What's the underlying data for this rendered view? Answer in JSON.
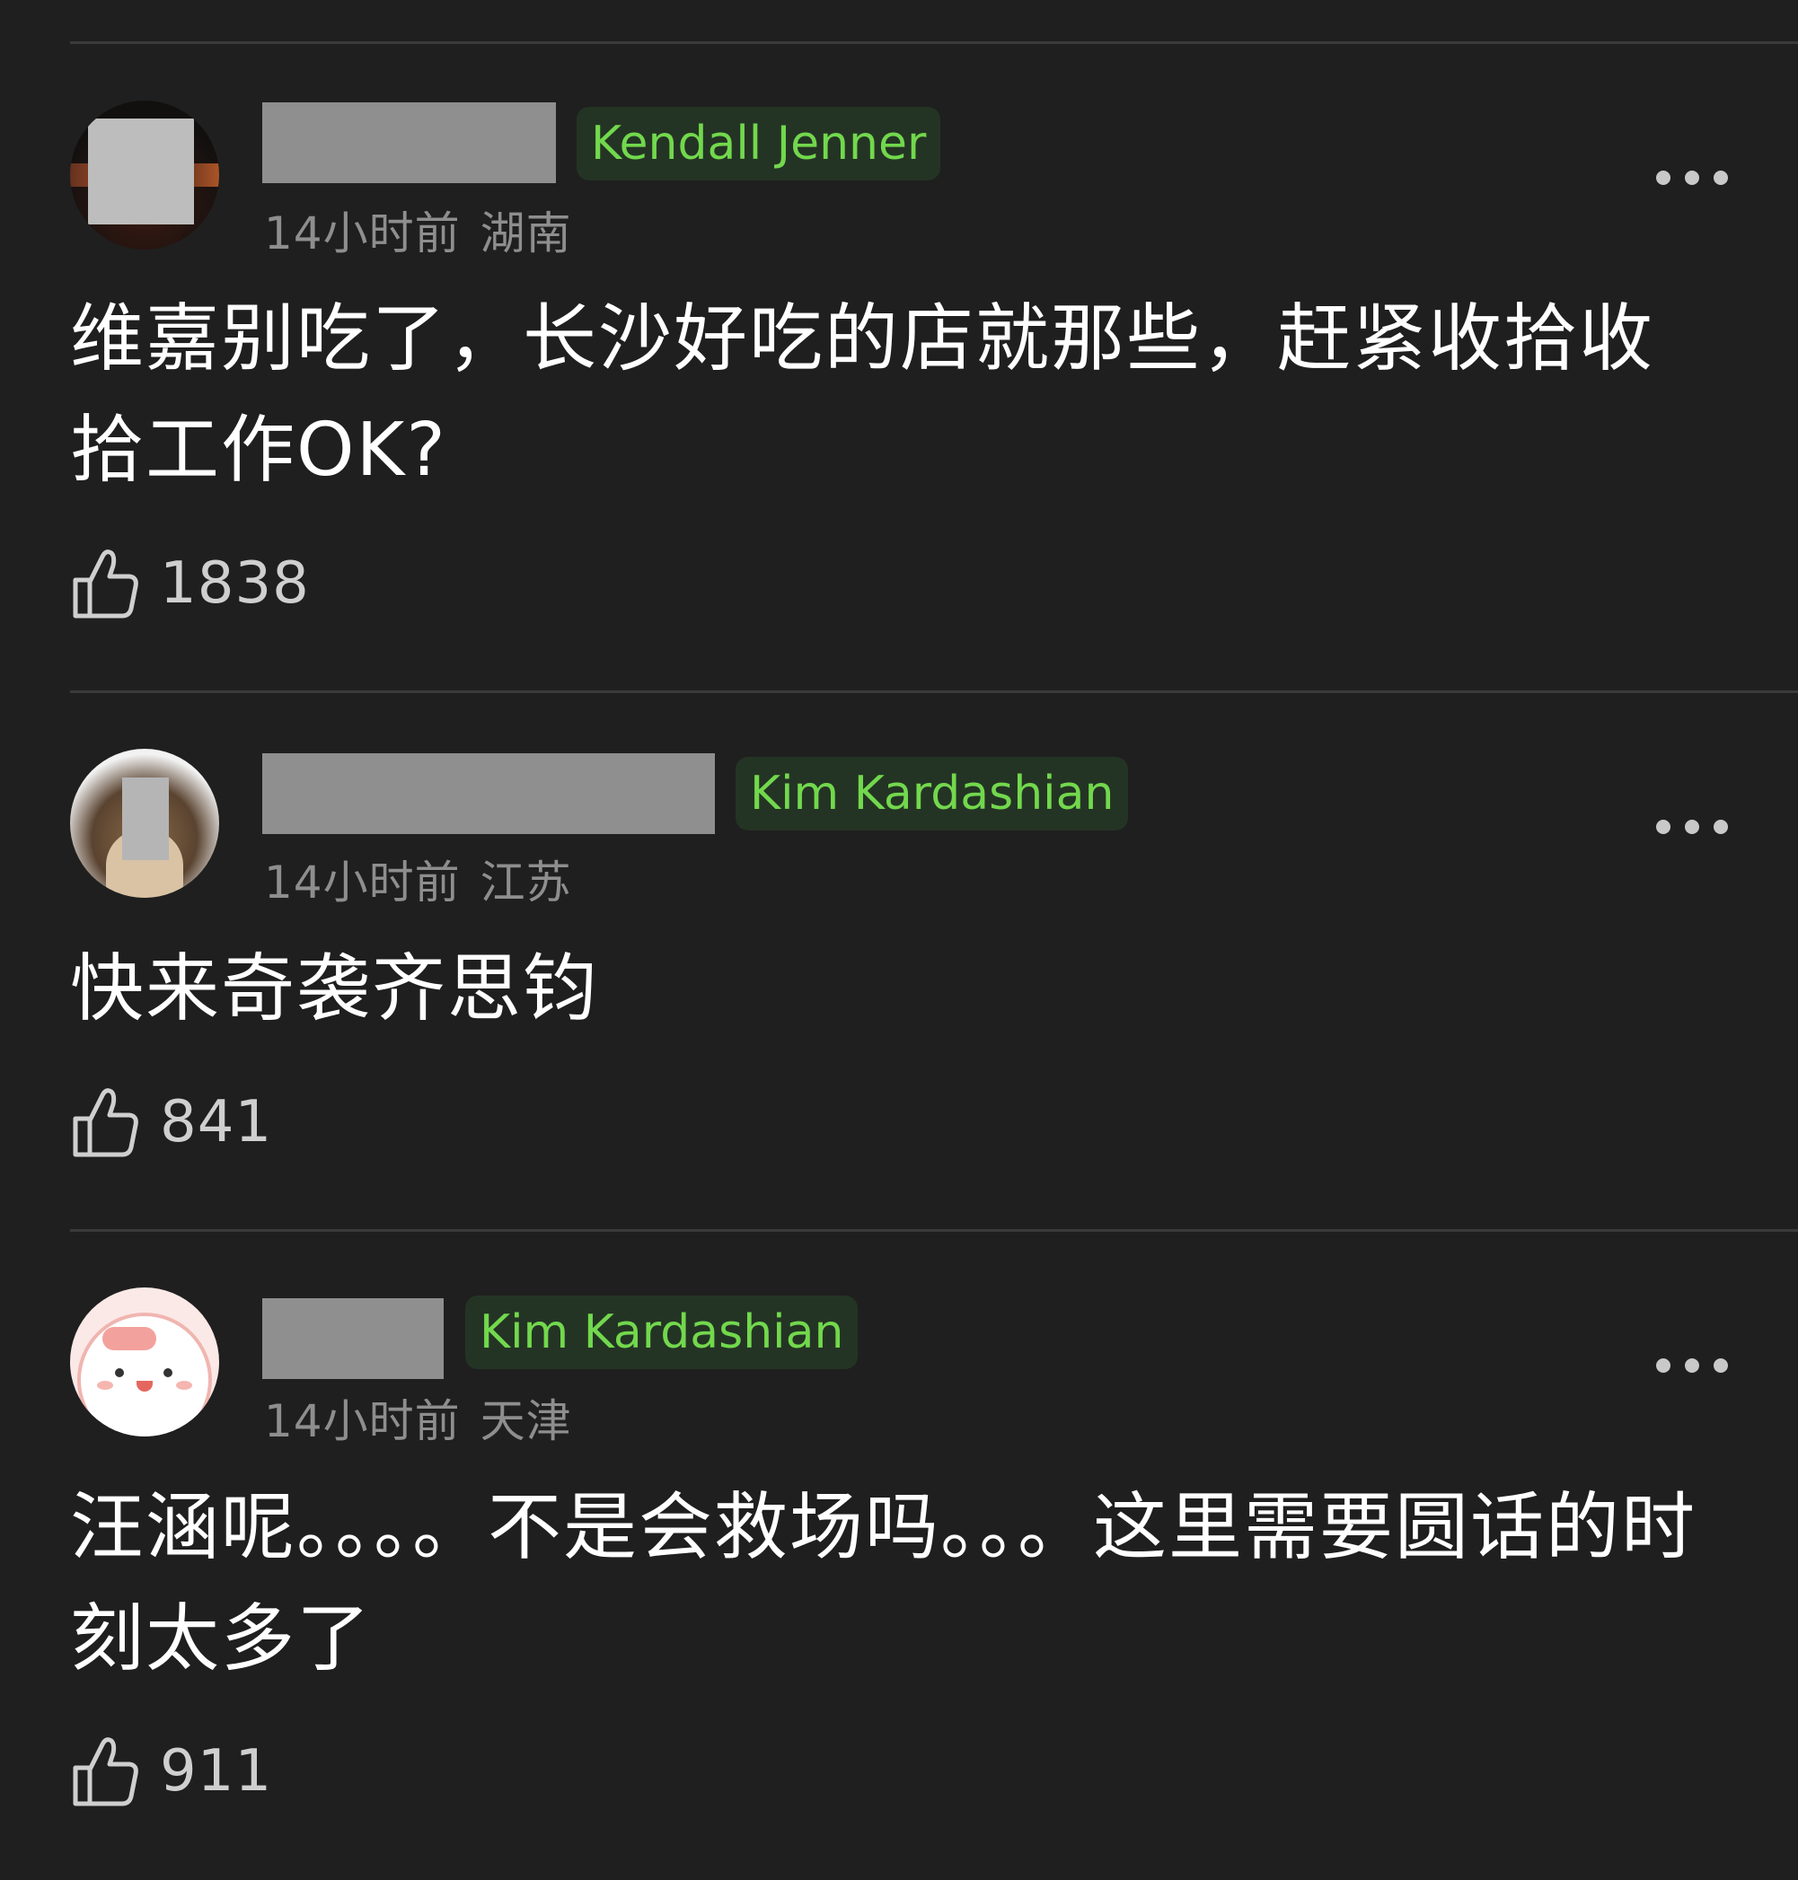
{
  "comments": [
    {
      "tag": "Kendall Jenner",
      "time": "14小时前",
      "location": "湖南",
      "text": "维嘉别吃了，长沙好吃的店就那些，赶紧收拾收拾工作OK?",
      "likes": "1838",
      "avatar_style": "dark-photo"
    },
    {
      "tag": "Kim Kardashian",
      "time": "14小时前",
      "location": "江苏",
      "text": "快来奇袭齐思钧",
      "likes": "841",
      "avatar_style": "animal-photo"
    },
    {
      "tag": "Kim Kardashian",
      "time": "14小时前",
      "location": "天津",
      "text": "汪涵呢。。。。不是会救场吗。。。这里需要圆话的时刻太多了",
      "likes": "911",
      "avatar_style": "pink-cartoon"
    }
  ],
  "icons": {
    "like": "thumbs-up-icon",
    "more": "more-dots-icon"
  },
  "colors": {
    "background": "#1f1f1f",
    "tag_text": "#72d84d",
    "tag_bg": "#243424",
    "meta_text": "#8e8e8e"
  }
}
